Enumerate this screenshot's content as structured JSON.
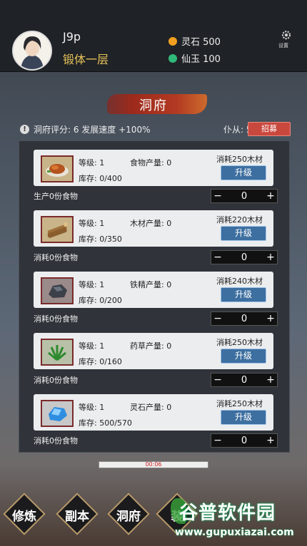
{
  "player": {
    "name": "J9p",
    "realm": "锻体一层"
  },
  "resources": {
    "spirit_stone": {
      "label": "灵石 500",
      "color": "#f0a020"
    },
    "immortal_jade": {
      "label": "仙玉 100",
      "color": "#2fb97a"
    }
  },
  "settings": {
    "label": "设置"
  },
  "page": {
    "title": "洞府"
  },
  "status": {
    "rating": "洞府评分: 6 发展速度 +100%",
    "servants": "仆从: 5",
    "recruit_label": "招募"
  },
  "buildings": [
    {
      "icon": "roast-meat",
      "level": "等级: 1",
      "production": "食物产量: 0",
      "stock": "库存: 0/400",
      "cost": "消耗250木材",
      "upgrade": "升级",
      "note": "生产0份食物",
      "qty": "0"
    },
    {
      "icon": "wood-logs",
      "level": "等级: 1",
      "production": "木材产量: 0",
      "stock": "库存: 0/350",
      "cost": "消耗220木材",
      "upgrade": "升级",
      "note": "消耗0份食物",
      "qty": "0"
    },
    {
      "icon": "iron-ore",
      "level": "等级: 1",
      "production": "铁精产量: 0",
      "stock": "库存: 0/200",
      "cost": "消耗240木材",
      "upgrade": "升级",
      "note": "消耗0份食物",
      "qty": "0"
    },
    {
      "icon": "herb",
      "level": "等级: 1",
      "production": "药草产量: 0",
      "stock": "库存: 0/160",
      "cost": "消耗250木材",
      "upgrade": "升级",
      "note": "消耗0份食物",
      "qty": "0"
    },
    {
      "icon": "spirit-crystal",
      "level": "等级: 1",
      "production": "灵石产量: 0",
      "stock": "库存: 500/570",
      "cost": "消耗250木材",
      "upgrade": "升级",
      "note": "消耗0份食物",
      "qty": "0"
    }
  ],
  "stepper": {
    "minus": "−",
    "plus": "+"
  },
  "timer": {
    "text": "00:06"
  },
  "nav": {
    "cultivate": "修炼",
    "dungeon": "副本",
    "cave": "洞府",
    "partial": "装"
  },
  "watermark": {
    "brand": "谷普软件园",
    "url": "www.gupuxiazai.com"
  }
}
